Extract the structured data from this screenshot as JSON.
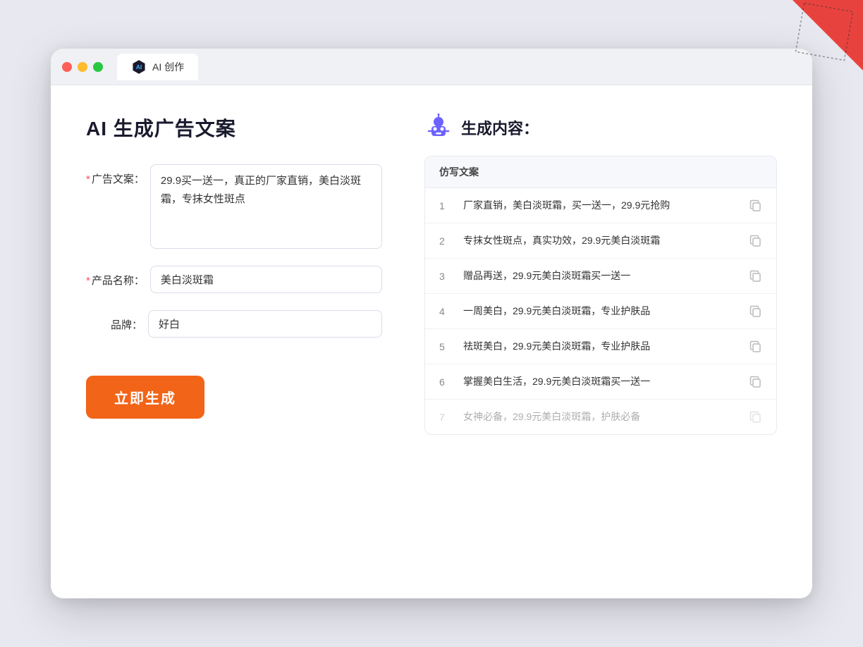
{
  "browser": {
    "tab_label": "AI 创作"
  },
  "page": {
    "title": "AI 生成广告文案",
    "results_header": "生成内容："
  },
  "form": {
    "ad_copy_label": "广告文案：",
    "ad_copy_required": true,
    "ad_copy_value": "29.9买一送一，真正的厂家直销，美白淡斑霜，专抹女性斑点",
    "product_name_label": "产品名称：",
    "product_name_required": true,
    "product_name_value": "美白淡斑霜",
    "brand_label": "品牌：",
    "brand_required": false,
    "brand_value": "好白",
    "generate_btn": "立即生成"
  },
  "results": {
    "column_header": "仿写文案",
    "items": [
      {
        "num": "1",
        "text": "厂家直销，美白淡斑霜，买一送一，29.9元抢购",
        "faded": false
      },
      {
        "num": "2",
        "text": "专抹女性斑点，真实功效，29.9元美白淡斑霜",
        "faded": false
      },
      {
        "num": "3",
        "text": "赠品再送，29.9元美白淡斑霜买一送一",
        "faded": false
      },
      {
        "num": "4",
        "text": "一周美白，29.9元美白淡斑霜，专业护肤品",
        "faded": false
      },
      {
        "num": "5",
        "text": "祛斑美白，29.9元美白淡斑霜，专业护肤品",
        "faded": false
      },
      {
        "num": "6",
        "text": "掌握美白生活，29.9元美白淡斑霜买一送一",
        "faded": false
      },
      {
        "num": "7",
        "text": "女神必备，29.9元美白淡斑霜，护肤必备",
        "faded": true
      }
    ]
  }
}
